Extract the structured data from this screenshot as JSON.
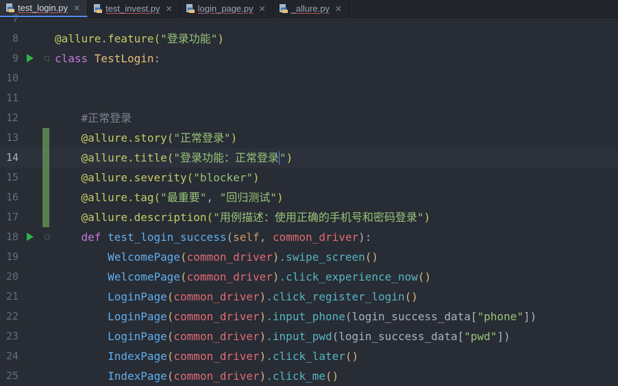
{
  "tabs": [
    {
      "label": "test_login.py",
      "close": "✕",
      "active": true
    },
    {
      "label": "test_invest.py",
      "close": "✕",
      "active": false
    },
    {
      "label": "login_page.py",
      "close": "✕",
      "active": false
    },
    {
      "label": "_allure.py",
      "close": "✕",
      "active": false
    }
  ],
  "editor": {
    "lines": [
      {
        "number": "7",
        "segments": []
      },
      {
        "number": "8",
        "segments": [
          {
            "text": "@allure.feature(",
            "class": "t-dec"
          },
          {
            "text": "\"登录功能\"",
            "class": "t-str"
          },
          {
            "text": ")",
            "class": "t-dec"
          }
        ]
      },
      {
        "number": "9",
        "run": true,
        "fold": true,
        "segments": [
          {
            "text": "class ",
            "class": "t-kw"
          },
          {
            "text": "TestLogin",
            "class": "t-cls"
          },
          {
            "text": ":",
            "class": "t-plain"
          }
        ]
      },
      {
        "number": "10",
        "segments": []
      },
      {
        "number": "11",
        "segments": []
      },
      {
        "number": "12",
        "segments": [
          {
            "text": "    #正常登录",
            "class": "t-cm"
          }
        ]
      },
      {
        "number": "13",
        "changed": true,
        "segments": [
          {
            "text": "    @allure.story(",
            "class": "t-dec"
          },
          {
            "text": "\"正常登录\"",
            "class": "t-str"
          },
          {
            "text": ")",
            "class": "t-dec"
          }
        ]
      },
      {
        "number": "14",
        "changed": true,
        "current": true,
        "segments": [
          {
            "text": "    @allure.title(",
            "class": "t-dec"
          },
          {
            "text": "\"登录功能：正常登录",
            "class": "t-str"
          },
          {
            "caret": true
          },
          {
            "text": "\"",
            "class": "t-str"
          },
          {
            "text": ")",
            "class": "t-dec"
          }
        ]
      },
      {
        "number": "15",
        "changed": true,
        "segments": [
          {
            "text": "    @allure.severity(",
            "class": "t-dec"
          },
          {
            "text": "\"blocker\"",
            "class": "t-str"
          },
          {
            "text": ")",
            "class": "t-dec"
          }
        ]
      },
      {
        "number": "16",
        "changed": true,
        "segments": [
          {
            "text": "    @allure.tag(",
            "class": "t-dec"
          },
          {
            "text": "\"最重要\"",
            "class": "t-str"
          },
          {
            "text": ", ",
            "class": "t-plain"
          },
          {
            "text": "\"回归测试\"",
            "class": "t-str"
          },
          {
            "text": ")",
            "class": "t-dec"
          }
        ]
      },
      {
        "number": "17",
        "changed": true,
        "segments": [
          {
            "text": "    @allure.description(",
            "class": "t-dec"
          },
          {
            "text": "\"用例描述：使用正确的手机号和密码登录\"",
            "class": "t-str"
          },
          {
            "text": ")",
            "class": "t-dec"
          }
        ]
      },
      {
        "number": "18",
        "run": true,
        "fold": true,
        "segments": [
          {
            "text": "    def ",
            "class": "t-kw"
          },
          {
            "text": "test_login_success",
            "class": "t-fn"
          },
          {
            "text": "(",
            "class": "t-plain"
          },
          {
            "text": "self",
            "class": "t-self"
          },
          {
            "text": ", ",
            "class": "t-plain"
          },
          {
            "text": "common_driver",
            "class": "t-param"
          },
          {
            "text": "):",
            "class": "t-plain"
          }
        ]
      },
      {
        "number": "19",
        "segments": [
          {
            "text": "        WelcomePage",
            "class": "t-fn"
          },
          {
            "text": "(",
            "class": "t-br"
          },
          {
            "text": "common_driver",
            "class": "t-param"
          },
          {
            "text": ")",
            "class": "t-br"
          },
          {
            "text": ".swipe_screen",
            "class": "t-call"
          },
          {
            "text": "()",
            "class": "t-br"
          }
        ]
      },
      {
        "number": "20",
        "segments": [
          {
            "text": "        WelcomePage",
            "class": "t-fn"
          },
          {
            "text": "(",
            "class": "t-br"
          },
          {
            "text": "common_driver",
            "class": "t-param"
          },
          {
            "text": ")",
            "class": "t-br"
          },
          {
            "text": ".click_experience_now",
            "class": "t-call"
          },
          {
            "text": "()",
            "class": "t-br"
          }
        ]
      },
      {
        "number": "21",
        "segments": [
          {
            "text": "        LoginPage",
            "class": "t-fn"
          },
          {
            "text": "(",
            "class": "t-br"
          },
          {
            "text": "common_driver",
            "class": "t-param"
          },
          {
            "text": ")",
            "class": "t-br"
          },
          {
            "text": ".click_register_login",
            "class": "t-call"
          },
          {
            "text": "()",
            "class": "t-br"
          }
        ]
      },
      {
        "number": "22",
        "segments": [
          {
            "text": "        LoginPage",
            "class": "t-fn"
          },
          {
            "text": "(",
            "class": "t-br"
          },
          {
            "text": "common_driver",
            "class": "t-param"
          },
          {
            "text": ")",
            "class": "t-br"
          },
          {
            "text": ".input_phone",
            "class": "t-call"
          },
          {
            "text": "(login_success_data[",
            "class": "t-plain"
          },
          {
            "text": "\"phone\"",
            "class": "t-str"
          },
          {
            "text": "])",
            "class": "t-plain"
          }
        ]
      },
      {
        "number": "23",
        "segments": [
          {
            "text": "        LoginPage",
            "class": "t-fn"
          },
          {
            "text": "(",
            "class": "t-br"
          },
          {
            "text": "common_driver",
            "class": "t-param"
          },
          {
            "text": ")",
            "class": "t-br"
          },
          {
            "text": ".input_pwd",
            "class": "t-call"
          },
          {
            "text": "(login_success_data[",
            "class": "t-plain"
          },
          {
            "text": "\"pwd\"",
            "class": "t-str"
          },
          {
            "text": "])",
            "class": "t-plain"
          }
        ]
      },
      {
        "number": "24",
        "segments": [
          {
            "text": "        IndexPage",
            "class": "t-fn"
          },
          {
            "text": "(",
            "class": "t-br"
          },
          {
            "text": "common_driver",
            "class": "t-param"
          },
          {
            "text": ")",
            "class": "t-br"
          },
          {
            "text": ".click_later",
            "class": "t-call"
          },
          {
            "text": "()",
            "class": "t-br"
          }
        ]
      },
      {
        "number": "25",
        "segments": [
          {
            "text": "        IndexPage",
            "class": "t-fn"
          },
          {
            "text": "(",
            "class": "t-br"
          },
          {
            "text": "common_driver",
            "class": "t-param"
          },
          {
            "text": ")",
            "class": "t-br"
          },
          {
            "text": ".click_me",
            "class": "t-call"
          },
          {
            "text": "()",
            "class": "t-br"
          }
        ]
      }
    ]
  },
  "colors": {
    "background": "#282c34",
    "tab_bar": "#21252b",
    "run_marker": "#2fb34c",
    "change_marker": "#6a9955"
  }
}
